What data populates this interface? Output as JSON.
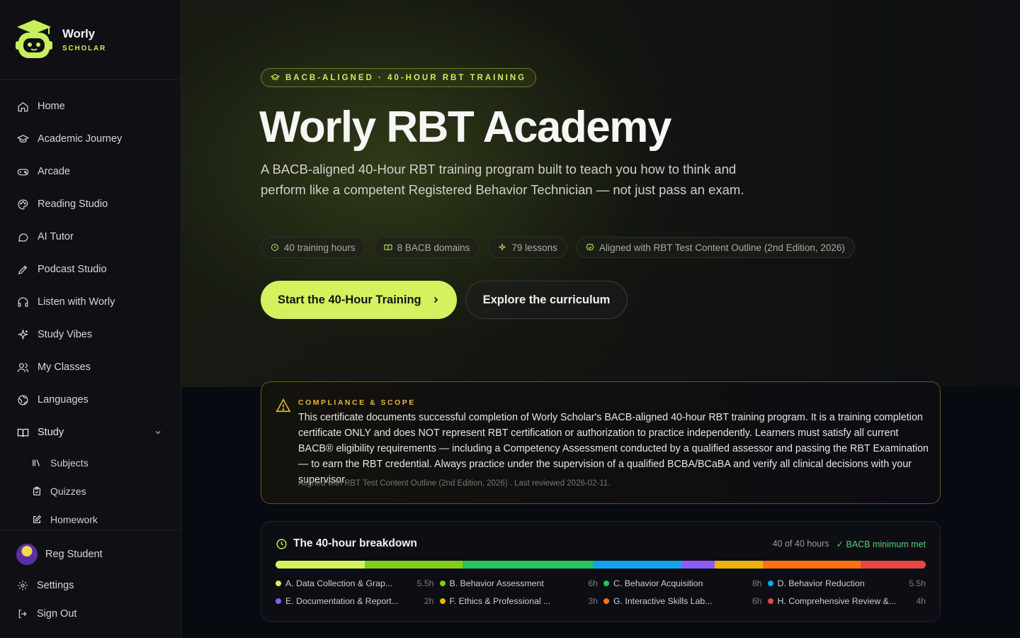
{
  "brand": {
    "name": "Worly",
    "sub": "SCHOLAR"
  },
  "nav": [
    {
      "label": "Home",
      "icon": "home-icon"
    },
    {
      "label": "Academic Journey",
      "icon": "graduation-cap-icon"
    },
    {
      "label": "Arcade",
      "icon": "gamepad-icon"
    },
    {
      "label": "Reading Studio",
      "icon": "palette-icon"
    },
    {
      "label": "AI Tutor",
      "icon": "chat-bubble-icon"
    },
    {
      "label": "Podcast Studio",
      "icon": "pen-icon"
    },
    {
      "label": "Listen with Worly",
      "icon": "headphones-icon"
    },
    {
      "label": "Study Vibes",
      "icon": "sparkles-icon"
    },
    {
      "label": "My Classes",
      "icon": "users-icon"
    },
    {
      "label": "Languages",
      "icon": "globe-icon"
    }
  ],
  "study": {
    "label": "Study",
    "items": [
      {
        "label": "Subjects",
        "icon": "library-icon"
      },
      {
        "label": "Quizzes",
        "icon": "clipboard-icon"
      },
      {
        "label": "Homework",
        "icon": "edit-icon"
      }
    ]
  },
  "user": {
    "name": "Reg Student"
  },
  "bottom": {
    "settings": "Settings",
    "signout": "Sign Out"
  },
  "hero": {
    "pill": "BACB-ALIGNED · 40-HOUR RBT TRAINING",
    "title": "Worly RBT Academy",
    "description": "A BACB-aligned 40-Hour RBT training program built to teach you how to think and perform like a competent Registered Behavior Technician — not just pass an exam.",
    "chips": [
      {
        "label": "40 training hours",
        "icon": "clock-icon"
      },
      {
        "label": "8 BACB domains",
        "icon": "book-icon"
      },
      {
        "label": "79 lessons",
        "icon": "sparkles-icon"
      },
      {
        "label": "Aligned with RBT Test Content Outline (2nd Edition, 2026)",
        "icon": "badge-check-icon"
      }
    ],
    "primary_cta": "Start the 40-Hour Training",
    "secondary_cta": "Explore the curriculum"
  },
  "compliance": {
    "heading": "COMPLIANCE & SCOPE",
    "body": "This certificate documents successful completion of Worly Scholar's BACB-aligned 40-hour RBT training program. It is a training completion certificate ONLY and does NOT represent RBT certification or authorization to practice independently. Learners must satisfy all current BACB® eligibility requirements — including a Competency Assessment conducted by a qualified assessor and passing the RBT Examination — to earn the RBT credential. Always practice under the supervision of a qualified BCBA/BCaBA and verify all clinical decisions with your supervisor.",
    "footer": "Aligned with RBT Test Content Outline (2nd Edition, 2026) . Last reviewed 2026-02-11."
  },
  "breakdown": {
    "title": "The 40-hour breakdown",
    "hours_summary": "40 of 40 hours",
    "status": "✓ BACB minimum met",
    "total_hours": 40,
    "domains": [
      {
        "label": "A. Data Collection & Grap...",
        "hours": 5.5,
        "hours_label": "5.5h",
        "color": "#d4f15e"
      },
      {
        "label": "B. Behavior Assessment",
        "hours": 6,
        "hours_label": "6h",
        "color": "#84cc16"
      },
      {
        "label": "C. Behavior Acquisition",
        "hours": 8,
        "hours_label": "8h",
        "color": "#22c55e"
      },
      {
        "label": "D. Behavior Reduction",
        "hours": 5.5,
        "hours_label": "5.5h",
        "color": "#0ea5e9"
      },
      {
        "label": "E. Documentation & Report...",
        "hours": 2,
        "hours_label": "2h",
        "color": "#8b5cf6"
      },
      {
        "label": "F. Ethics & Professional ...",
        "hours": 3,
        "hours_label": "3h",
        "color": "#eab308"
      },
      {
        "label": "G. Interactive Skills Lab...",
        "hours": 6,
        "hours_label": "6h",
        "color": "#f97316"
      },
      {
        "label": "H. Comprehensive Review &...",
        "hours": 4,
        "hours_label": "4h",
        "color": "#ef4444"
      }
    ]
  },
  "colors": {
    "accent": "#d4f15e",
    "warning": "#e2b93b",
    "success": "#4cd37a"
  }
}
